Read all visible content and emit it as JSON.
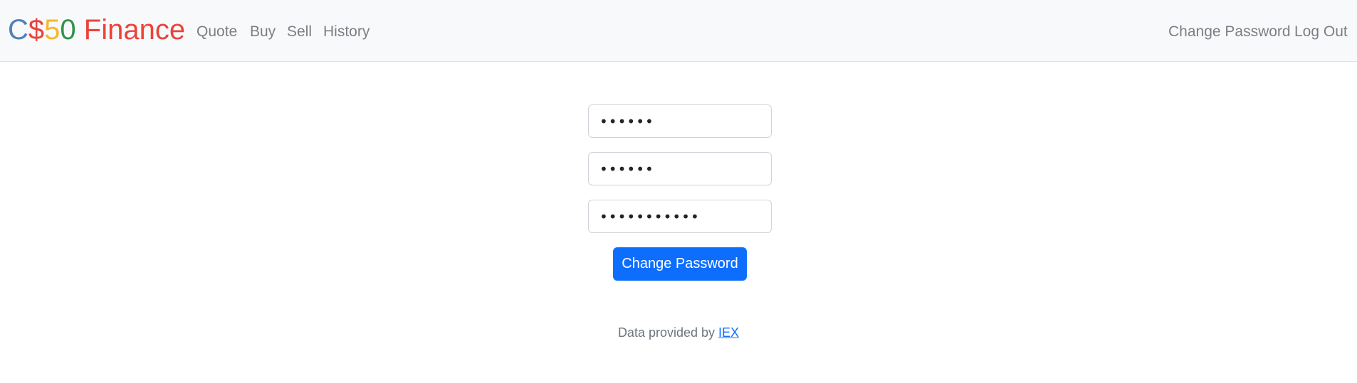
{
  "brand": {
    "part1": "C",
    "part2": "$",
    "part3": "5",
    "part4": "0",
    "part5": " Finance",
    "colors": {
      "blue": "#537fbe",
      "red": "#ea433b",
      "yellow": "#f5b82e",
      "green": "#2e944b"
    }
  },
  "nav": {
    "left": [
      {
        "label": "Quote"
      },
      {
        "label": "Buy"
      },
      {
        "label": "Sell"
      },
      {
        "label": "History"
      }
    ],
    "right": [
      {
        "label": "Change Password"
      },
      {
        "label": "Log Out"
      }
    ]
  },
  "form": {
    "fields": [
      {
        "value": "••••••"
      },
      {
        "value": "••••••"
      },
      {
        "value": "•••••••••••"
      }
    ],
    "submit_label": "Change Password"
  },
  "footer": {
    "text": "Data provided by ",
    "link_label": "IEX"
  },
  "colors": {
    "primary": "#0d6efd",
    "navbar_bg": "#f8f9fa",
    "nav_link": "#7a7f86"
  }
}
